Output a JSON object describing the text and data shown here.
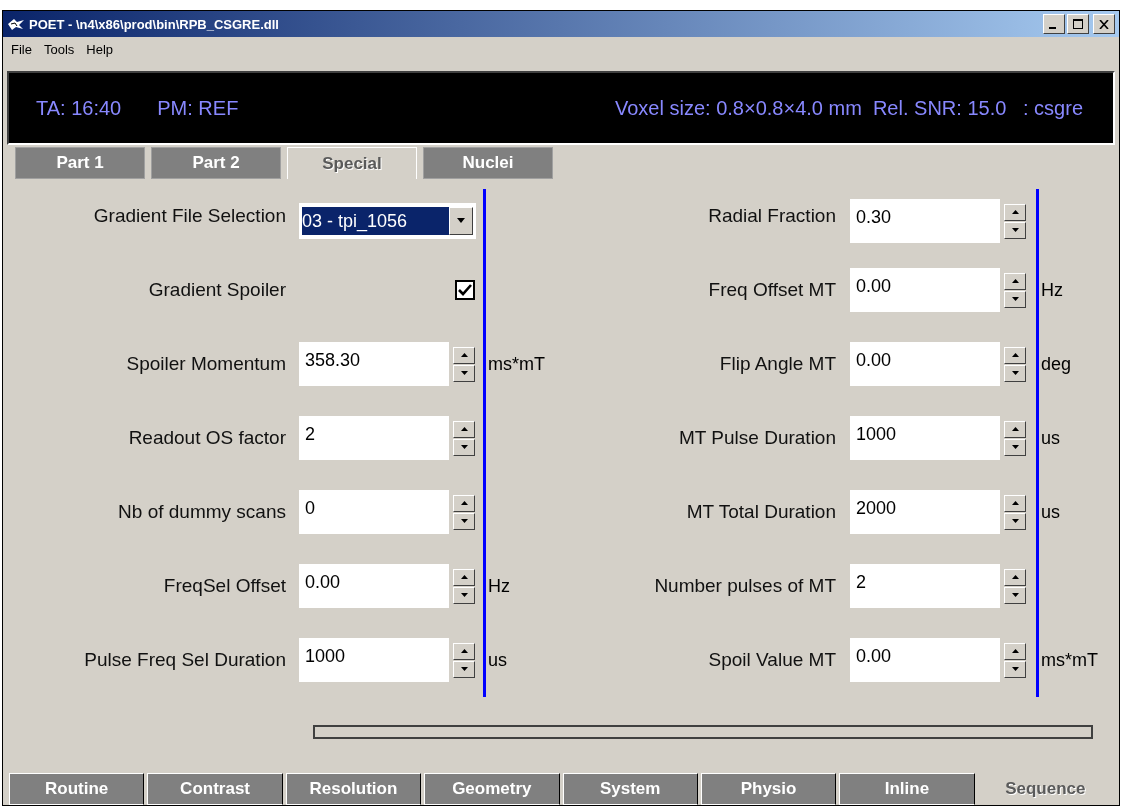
{
  "window": {
    "title": "POET - \\n4\\x86\\prod\\bin\\RPB_CSGRE.dll"
  },
  "menu": [
    "File",
    "Tools",
    "Help"
  ],
  "info_bar": {
    "left": [
      "TA: 16:40",
      "PM: REF"
    ],
    "right": "Voxel size: 0.8×0.8×4.0 mm  Rel. SNR: 15.0   : csgre"
  },
  "top_tabs": [
    {
      "label": "Part 1",
      "selected": false
    },
    {
      "label": "Part 2",
      "selected": false
    },
    {
      "label": "Special",
      "selected": true
    },
    {
      "label": "Nuclei",
      "selected": false
    }
  ],
  "left_params": [
    {
      "kind": "dropdown",
      "label": "Gradient File Selection",
      "value": "03 - tpi_1056"
    },
    {
      "kind": "checkbox",
      "label": "Gradient Spoiler",
      "checked": true
    },
    {
      "kind": "spin",
      "label": "Spoiler Momentum",
      "value": "358.30",
      "unit": "ms*mT"
    },
    {
      "kind": "spin",
      "label": "Readout OS factor",
      "value": "2"
    },
    {
      "kind": "spin",
      "label": "Nb of dummy scans",
      "value": "0"
    },
    {
      "kind": "spin",
      "label": "FreqSel Offset",
      "value": "0.00",
      "unit": "Hz"
    },
    {
      "kind": "spin",
      "label": "Pulse Freq Sel Duration",
      "value": "1000",
      "unit": "us"
    }
  ],
  "right_params": [
    {
      "kind": "spin",
      "label": "Radial Fraction",
      "value": "0.30"
    },
    {
      "kind": "spin",
      "label": "Freq Offset MT",
      "value": "0.00",
      "unit": "Hz"
    },
    {
      "kind": "spin",
      "label": "Flip Angle MT",
      "value": "0.00",
      "unit": "deg"
    },
    {
      "kind": "spin",
      "label": "MT Pulse Duration",
      "value": "1000",
      "unit": "us"
    },
    {
      "kind": "spin",
      "label": "MT Total Duration",
      "value": "2000",
      "unit": "us"
    },
    {
      "kind": "spin",
      "label": "Number pulses of MT",
      "value": "2"
    },
    {
      "kind": "spin",
      "label": "Spoil Value MT",
      "value": "0.00",
      "unit": "ms*mT"
    }
  ],
  "bottom_tabs": [
    {
      "label": "Routine",
      "selected": false
    },
    {
      "label": "Contrast",
      "selected": false
    },
    {
      "label": "Resolution",
      "selected": false
    },
    {
      "label": "Geometry",
      "selected": false
    },
    {
      "label": "System",
      "selected": false
    },
    {
      "label": "Physio",
      "selected": false
    },
    {
      "label": "Inline",
      "selected": false
    },
    {
      "label": "Sequence",
      "selected": true
    }
  ]
}
